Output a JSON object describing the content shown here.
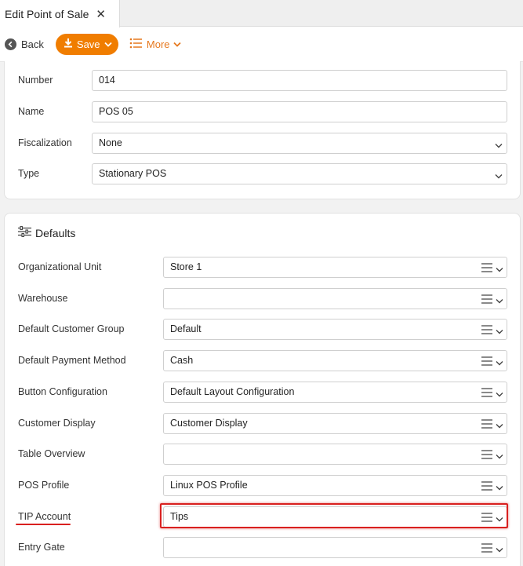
{
  "tab": {
    "title": "Edit Point of Sale"
  },
  "toolbar": {
    "back_label": "Back",
    "save_label": "Save",
    "more_label": "More"
  },
  "colors": {
    "accent": "#f07d00",
    "highlight": "#d9201f"
  },
  "general": {
    "number": {
      "label": "Number",
      "value": "014"
    },
    "name": {
      "label": "Name",
      "value": "POS 05"
    },
    "fiscalization": {
      "label": "Fiscalization",
      "value": "None"
    },
    "type": {
      "label": "Type",
      "value": "Stationary POS"
    }
  },
  "defaults": {
    "title": "Defaults",
    "fields": [
      {
        "label": "Organizational Unit",
        "value": "Store 1"
      },
      {
        "label": "Warehouse",
        "value": ""
      },
      {
        "label": "Default Customer Group",
        "value": "Default"
      },
      {
        "label": "Default Payment Method",
        "value": "Cash"
      },
      {
        "label": "Button Configuration",
        "value": "Default Layout Configuration"
      },
      {
        "label": "Customer Display",
        "value": "Customer Display"
      },
      {
        "label": "Table Overview",
        "value": ""
      },
      {
        "label": "POS Profile",
        "value": "Linux POS Profile"
      },
      {
        "label": "TIP Account",
        "value": "Tips"
      },
      {
        "label": "Entry Gate",
        "value": ""
      }
    ]
  }
}
